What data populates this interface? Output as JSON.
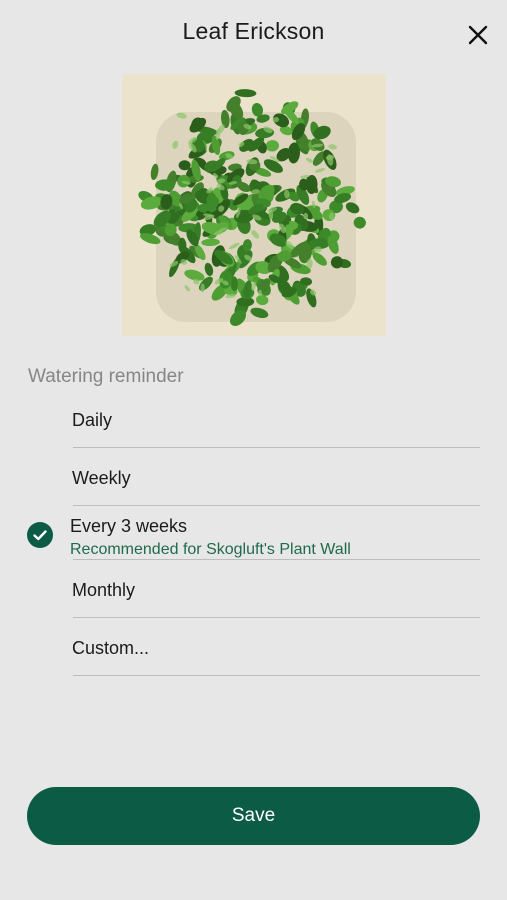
{
  "header": {
    "title": "Leaf Erickson"
  },
  "watering": {
    "label": "Watering reminder",
    "options": [
      {
        "label": "Daily"
      },
      {
        "label": "Weekly"
      },
      {
        "label": "Every 3 weeks",
        "sublabel": "Recommended for Skogluft's Plant Wall",
        "selected": true
      },
      {
        "label": "Monthly"
      },
      {
        "label": "Custom..."
      }
    ]
  },
  "save_label": "Save",
  "colors": {
    "accent": "#0c5b45",
    "recommend_text": "#1f6a4d",
    "background": "#e7e7e7"
  },
  "icons": {
    "close": "close-icon",
    "check": "check-circle-icon"
  }
}
